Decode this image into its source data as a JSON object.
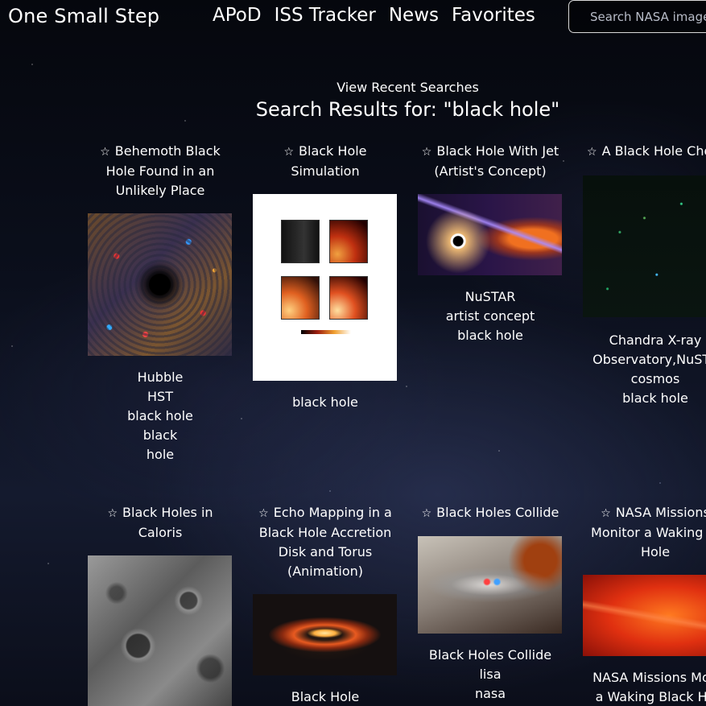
{
  "header": {
    "brand": "One Small Step",
    "nav": [
      "APoD",
      "ISS Tracker",
      "News",
      "Favorites"
    ],
    "search_placeholder": "Search NASA images"
  },
  "recent_searches_label": "View Recent Searches",
  "results_title": "Search Results for: \"black hole\"",
  "favorite_icon": "star-outline-icon",
  "results": [
    {
      "title": "Behemoth Black Hole Found in an Unlikely Place",
      "thumbnail": "black-hole-starfield-image",
      "keywords": [
        "Hubble",
        "HST",
        "black hole",
        "black",
        "hole"
      ]
    },
    {
      "title": "Black Hole Simulation",
      "thumbnail": "simulation-plot-image",
      "keywords": [
        "black hole"
      ]
    },
    {
      "title": "Black Hole With Jet (Artist's Concept)",
      "thumbnail": "black-hole-jet-image",
      "keywords": [
        "NuSTAR",
        "artist concept",
        "black hole"
      ]
    },
    {
      "title": "A Black Hole Cho",
      "thumbnail": "chandra-field-image",
      "keywords": [
        "Chandra X-ray",
        "Observatory,NuSTA",
        "cosmos",
        "black hole"
      ]
    },
    {
      "title": "Black Holes in Caloris",
      "thumbnail": "caloris-surface-image",
      "keywords": []
    },
    {
      "title": "Echo Mapping in a Black Hole Accretion Disk and Torus (Animation)",
      "thumbnail": "accretion-disk-image",
      "keywords": [
        "Black Hole"
      ]
    },
    {
      "title": "Black Holes Collide",
      "thumbnail": "black-holes-collide-image",
      "keywords": [
        "Black Holes Collide",
        "lisa",
        "nasa"
      ]
    },
    {
      "title": "NASA Missions Monitor a Waking Bl Hole",
      "thumbnail": "waking-black-hole-image",
      "keywords": [
        "NASA Missions Mon",
        "a Waking Black Ho"
      ]
    }
  ]
}
